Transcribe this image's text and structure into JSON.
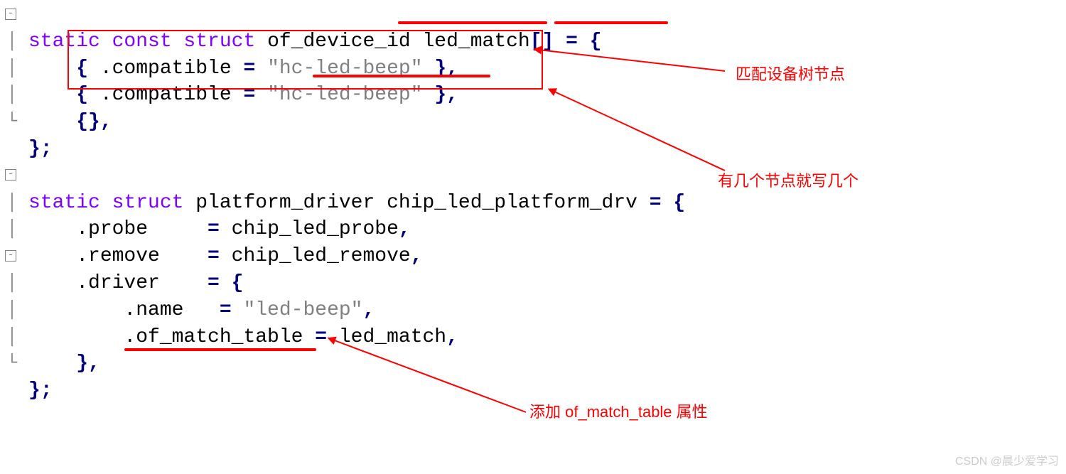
{
  "code": {
    "l1_kw": "static const struct",
    "l1_rest": " of_device_id led_match",
    "l1_tail": "[] ",
    "l1_op1": "= {",
    "l2_a": "    { ",
    "l2_b": ".compatible ",
    "l2_c": "= ",
    "l2_str": "\"hc-led-beep\"",
    "l2_d": " },",
    "l3_a": "    { ",
    "l3_b": ".compatible ",
    "l3_c": "= ",
    "l3_str": "\"hc-led-beep\"",
    "l3_d": " },",
    "l4": "    {},",
    "l5": "};",
    "blank": "",
    "l7_kw": "static struct",
    "l7_rest": " platform_driver chip_led_platform_drv ",
    "l7_op": "= {",
    "l8": "    .probe     ",
    "l8_op": "= ",
    "l8_b": "chip_led_probe",
    "l8_c": ",",
    "l9": "    .remove    ",
    "l9_op": "= ",
    "l9_b": "chip_led_remove",
    "l9_c": ",",
    "l10": "    .driver    ",
    "l10_op": "= {",
    "l11": "        .name   ",
    "l11_op": "= ",
    "l11_str": "\"led-beep\"",
    "l11_c": ",",
    "l12": "        .of_match_table ",
    "l12_op": "= ",
    "l12_b": "led_match",
    "l12_c": ",",
    "l13": "    },",
    "l14": "};"
  },
  "gutter": {
    "minus": "−",
    "end": "∟"
  },
  "annotations": {
    "a1": "匹配设备树节点",
    "a2": "有几个节点就写几个",
    "a3": "添加 of_match_table 属性"
  },
  "watermark": "CSDN @晨少爱学习"
}
